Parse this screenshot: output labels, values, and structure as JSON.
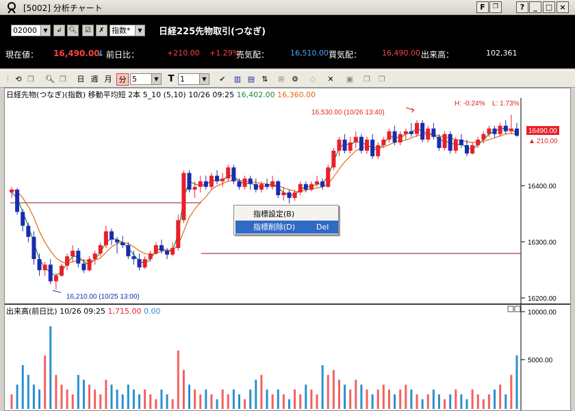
{
  "window": {
    "title": "[5002] 分析チャート",
    "btn_f": "F",
    "btn_help": "?",
    "btn_min": "_",
    "btn_max": "□",
    "btn_close": "×"
  },
  "header": {
    "code": "02000",
    "index_select": "指数*",
    "contract": "日経225先物取引(つなぎ)",
    "current_label": "現在値：",
    "current_value": "16,490.00",
    "arrow": "↓",
    "prev_label": "前日比：",
    "change": "+210.00",
    "change_pct": "+1.29%",
    "sell_label": "売気配：",
    "sell_value": "16,510.00",
    "buy_label": "買気配：",
    "buy_value": "16,490.00",
    "volume_label": "出来高：",
    "volume_value": "102,361"
  },
  "toolbar": {
    "day": "日",
    "week": "週",
    "month": "月",
    "minute": "分",
    "interval": "5",
    "type_label": "T",
    "type_value": "1"
  },
  "chart": {
    "info_prefix": "日経先物(つなぎ)(指数) 移動平均短 2本 5_10 (5,10) 10/26 09:25",
    "ma_short": "16,402.00",
    "ma_long": "16,360.00",
    "high_marker": "16,530.00 (10/26 13:40)",
    "low_marker": "16,210.00 (10/25 13:00)",
    "h_pct": "H: -0.24%",
    "l_pct": "L: 1.73%",
    "price_tag": "16490.00",
    "change_tag": "210.00",
    "y_labels": [
      "16400.00",
      "16300.00",
      "16200.00"
    ],
    "vol_info_prefix": "出来高(前日比) 10/26 09:25",
    "vol_up": "1,715.00",
    "vol_down": "0.00",
    "vol_labels": [
      "10000.00",
      "5000.00"
    ]
  },
  "context_menu": {
    "item1": "指標設定(B)",
    "item2": "指標削除(D)",
    "item2_shortcut": "Del"
  },
  "colors": {
    "up": "#e8202a",
    "down": "#1a2bb0",
    "ma_short": "#1a8a3a",
    "ma_long": "#e06a10",
    "vol_up": "#f26060",
    "vol_down": "#2a8ed0"
  },
  "chart_data": {
    "type": "candlestick",
    "ylim": [
      16200,
      16560
    ],
    "candles": [
      [
        16390,
        16400,
        16380,
        16395
      ],
      [
        16395,
        16398,
        16350,
        16355
      ],
      [
        16355,
        16360,
        16320,
        16330
      ],
      [
        16330,
        16335,
        16300,
        16310
      ],
      [
        16310,
        16320,
        16260,
        16270
      ],
      [
        16270,
        16280,
        16240,
        16250
      ],
      [
        16250,
        16265,
        16240,
        16260
      ],
      [
        16260,
        16270,
        16225,
        16230
      ],
      [
        16230,
        16245,
        16215,
        16240
      ],
      [
        16240,
        16262,
        16238,
        16258
      ],
      [
        16258,
        16280,
        16250,
        16275
      ],
      [
        16275,
        16295,
        16265,
        16285
      ],
      [
        16285,
        16290,
        16255,
        16262
      ],
      [
        16262,
        16270,
        16245,
        16250
      ],
      [
        16250,
        16275,
        16248,
        16270
      ],
      [
        16270,
        16285,
        16260,
        16280
      ],
      [
        16280,
        16300,
        16275,
        16295
      ],
      [
        16295,
        16330,
        16290,
        16320
      ],
      [
        16320,
        16325,
        16295,
        16305
      ],
      [
        16305,
        16310,
        16280,
        16300
      ],
      [
        16300,
        16312,
        16290,
        16295
      ],
      [
        16295,
        16300,
        16270,
        16275
      ],
      [
        16275,
        16285,
        16260,
        16270
      ],
      [
        16270,
        16280,
        16250,
        16255
      ],
      [
        16255,
        16275,
        16252,
        16270
      ],
      [
        16270,
        16285,
        16265,
        16280
      ],
      [
        16280,
        16300,
        16278,
        16295
      ],
      [
        16295,
        16305,
        16280,
        16285
      ],
      [
        16285,
        16290,
        16270,
        16278
      ],
      [
        16278,
        16300,
        16275,
        16290
      ],
      [
        16290,
        16350,
        16285,
        16340
      ],
      [
        16340,
        16430,
        16335,
        16425
      ],
      [
        16425,
        16430,
        16390,
        16395
      ],
      [
        16395,
        16410,
        16380,
        16400
      ],
      [
        16400,
        16420,
        16390,
        16410
      ],
      [
        16410,
        16420,
        16395,
        16400
      ],
      [
        16400,
        16425,
        16395,
        16420
      ],
      [
        16420,
        16430,
        16405,
        16410
      ],
      [
        16410,
        16425,
        16400,
        16415
      ],
      [
        16415,
        16440,
        16410,
        16435
      ],
      [
        16435,
        16440,
        16405,
        16410
      ],
      [
        16410,
        16415,
        16395,
        16400
      ],
      [
        16400,
        16420,
        16395,
        16415
      ],
      [
        16415,
        16420,
        16395,
        16405
      ],
      [
        16405,
        16415,
        16390,
        16395
      ],
      [
        16395,
        16410,
        16390,
        16405
      ],
      [
        16405,
        16415,
        16395,
        16400
      ],
      [
        16400,
        16420,
        16395,
        16410
      ],
      [
        16410,
        16412,
        16380,
        16385
      ],
      [
        16385,
        16400,
        16375,
        16390
      ],
      [
        16390,
        16395,
        16370,
        16380
      ],
      [
        16380,
        16395,
        16375,
        16390
      ],
      [
        16390,
        16410,
        16385,
        16405
      ],
      [
        16405,
        16410,
        16390,
        16395
      ],
      [
        16395,
        16410,
        16392,
        16405
      ],
      [
        16405,
        16420,
        16400,
        16410
      ],
      [
        16410,
        16415,
        16395,
        16400
      ],
      [
        16400,
        16440,
        16398,
        16435
      ],
      [
        16435,
        16470,
        16430,
        16465
      ],
      [
        16465,
        16490,
        16455,
        16485
      ],
      [
        16485,
        16495,
        16460,
        16465
      ],
      [
        16465,
        16490,
        16460,
        16480
      ],
      [
        16480,
        16500,
        16470,
        16490
      ],
      [
        16490,
        16495,
        16460,
        16465
      ],
      [
        16465,
        16490,
        16460,
        16485
      ],
      [
        16485,
        16495,
        16450,
        16455
      ],
      [
        16455,
        16480,
        16450,
        16475
      ],
      [
        16475,
        16490,
        16470,
        16485
      ],
      [
        16485,
        16505,
        16480,
        16500
      ],
      [
        16500,
        16510,
        16475,
        16480
      ],
      [
        16480,
        16500,
        16475,
        16495
      ],
      [
        16495,
        16505,
        16485,
        16500
      ],
      [
        16500,
        16515,
        16490,
        16495
      ],
      [
        16495,
        16520,
        16490,
        16515
      ],
      [
        16515,
        16520,
        16480,
        16485
      ],
      [
        16485,
        16510,
        16480,
        16505
      ],
      [
        16505,
        16515,
        16485,
        16490
      ],
      [
        16490,
        16495,
        16465,
        16470
      ],
      [
        16470,
        16500,
        16465,
        16495
      ],
      [
        16495,
        16500,
        16460,
        16465
      ],
      [
        16465,
        16490,
        16460,
        16485
      ],
      [
        16485,
        16495,
        16470,
        16475
      ],
      [
        16475,
        16485,
        16455,
        16460
      ],
      [
        16460,
        16480,
        16458,
        16475
      ],
      [
        16475,
        16490,
        16470,
        16485
      ],
      [
        16485,
        16500,
        16478,
        16495
      ],
      [
        16495,
        16510,
        16490,
        16505
      ],
      [
        16505,
        16510,
        16488,
        16495
      ],
      [
        16495,
        16515,
        16490,
        16510
      ],
      [
        16510,
        16520,
        16495,
        16500
      ],
      [
        16500,
        16530,
        16495,
        16505
      ],
      [
        16505,
        16515,
        16490,
        16492
      ]
    ],
    "volume": [
      0.15,
      0.25,
      0.45,
      0.35,
      0.25,
      0.2,
      0.55,
      0.85,
      0.35,
      0.25,
      0.2,
      0.15,
      0.35,
      0.3,
      0.25,
      0.2,
      0.15,
      0.3,
      0.25,
      0.2,
      0.15,
      0.25,
      0.2,
      0.15,
      0.2,
      0.15,
      0.1,
      0.2,
      0.15,
      0.1,
      0.6,
      0.4,
      0.25,
      0.2,
      0.15,
      0.2,
      0.15,
      0.1,
      0.2,
      0.15,
      0.2,
      0.15,
      0.1,
      0.2,
      0.3,
      0.35,
      0.2,
      0.15,
      0.2,
      0.15,
      0.1,
      0.2,
      0.15,
      0.25,
      0.2,
      0.15,
      0.45,
      0.35,
      0.4,
      0.3,
      0.25,
      0.2,
      0.3,
      0.25,
      0.2,
      0.15,
      0.2,
      0.25,
      0.2,
      0.15,
      0.2,
      0.25,
      0.2,
      0.15,
      0.1,
      0.15,
      0.2,
      0.15,
      0.1,
      0.15,
      0.2,
      0.15,
      0.1,
      0.2,
      0.15,
      0.1,
      0.15,
      0.2,
      0.25,
      0.15,
      0.35,
      0.55
    ],
    "ma_short": [
      16390,
      16380,
      16355,
      16330,
      16300,
      16270,
      16255,
      16245,
      16240,
      16248,
      16262,
      16275,
      16275,
      16265,
      16260,
      16270,
      16282,
      16300,
      16308,
      16305,
      16300,
      16290,
      16278,
      16266,
      16262,
      16270,
      16285,
      16290,
      16285,
      16285,
      16315,
      16380,
      16410,
      16405,
      16402,
      16405,
      16410,
      16412,
      16412,
      16420,
      16420,
      16410,
      16405,
      16408,
      16402,
      16400,
      16402,
      16405,
      16398,
      16390,
      16385,
      16385,
      16395,
      16400,
      16400,
      16405,
      16405,
      16420,
      16445,
      16470,
      16478,
      16475,
      16482,
      16480,
      16475,
      16470,
      16465,
      16478,
      16490,
      16490,
      16488,
      16495,
      16498,
      16505,
      16500,
      16495,
      16495,
      16485,
      16482,
      16480,
      16475,
      16478,
      16470,
      16468,
      16475,
      16485,
      16495,
      16500,
      16505,
      16505,
      16502,
      16498
    ],
    "ma_long": [
      16395,
      16392,
      16380,
      16365,
      16345,
      16320,
      16300,
      16285,
      16272,
      16265,
      16262,
      16265,
      16268,
      16268,
      16266,
      16268,
      16272,
      16282,
      16292,
      16298,
      16300,
      16298,
      16292,
      16285,
      16280,
      16278,
      16280,
      16284,
      16286,
      16286,
      16295,
      16320,
      16345,
      16360,
      16372,
      16382,
      16395,
      16402,
      16406,
      16410,
      16412,
      16412,
      16410,
      16410,
      16408,
      16406,
      16405,
      16404,
      16402,
      16398,
      16395,
      16392,
      16392,
      16394,
      16396,
      16398,
      16400,
      16405,
      16418,
      16432,
      16445,
      16455,
      16465,
      16470,
      16472,
      16472,
      16470,
      16472,
      16476,
      16480,
      16482,
      16484,
      16488,
      16492,
      16494,
      16494,
      16494,
      16492,
      16490,
      16488,
      16485,
      16484,
      16481,
      16480,
      16480,
      16482,
      16485,
      16488,
      16492,
      16495,
      16496,
      16495
    ]
  }
}
